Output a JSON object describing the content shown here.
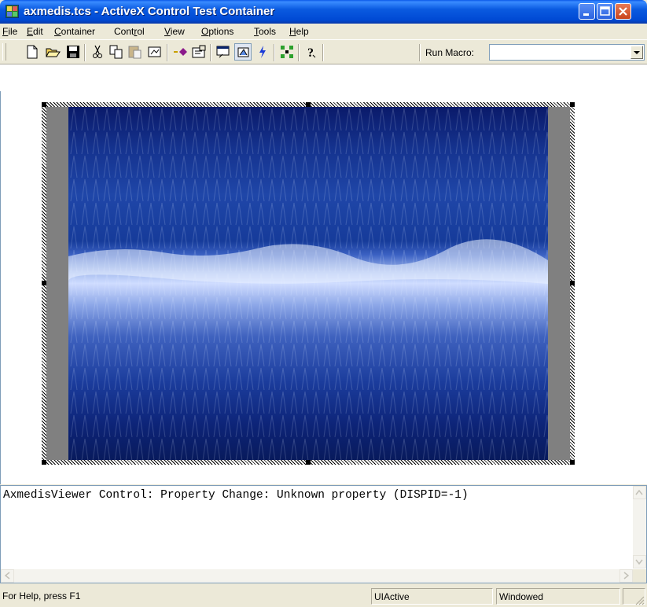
{
  "window": {
    "title": "axmedis.tcs - ActiveX Control Test Container",
    "controls": {
      "minimize": "minimize",
      "maximize": "maximize",
      "close": "close"
    }
  },
  "menu": {
    "items": [
      {
        "label": "File",
        "accel": "F",
        "rest": "ile"
      },
      {
        "label": "Edit",
        "accel": "E",
        "rest": "dit"
      },
      {
        "label": "Container",
        "accel": "C",
        "rest": "ontainer"
      },
      {
        "label": "Control",
        "pre": "Cont",
        "accel": "r",
        "rest": "ol"
      },
      {
        "label": "View",
        "accel": "V",
        "rest": "iew"
      },
      {
        "label": "Options",
        "accel": "O",
        "rest": "ptions"
      },
      {
        "label": "Tools",
        "accel": "T",
        "rest": "ools"
      },
      {
        "label": "Help",
        "accel": "H",
        "rest": "elp"
      }
    ]
  },
  "toolbar": {
    "buttons": [
      "new-icon",
      "open-icon",
      "save-icon",
      "cut-icon",
      "copy-icon",
      "paste-icon",
      "paste-special-icon",
      "insert-control-icon",
      "properties-icon",
      "invoke-methods-icon",
      "draw-meta-icon",
      "events-icon",
      "network-icon",
      "help-icon"
    ],
    "run_macro_label": "Run Macro:",
    "run_macro_value": ""
  },
  "output": {
    "line1": "AxmedisViewer Control: Property Change: Unknown property (DISPID=-1)"
  },
  "status": {
    "help": "For Help, press F1",
    "state": "UIActive",
    "mode": "Windowed"
  },
  "colors": {
    "titlebar": "#0a5ae0",
    "close_button": "#c9441c",
    "chrome": "#ece9d8"
  }
}
